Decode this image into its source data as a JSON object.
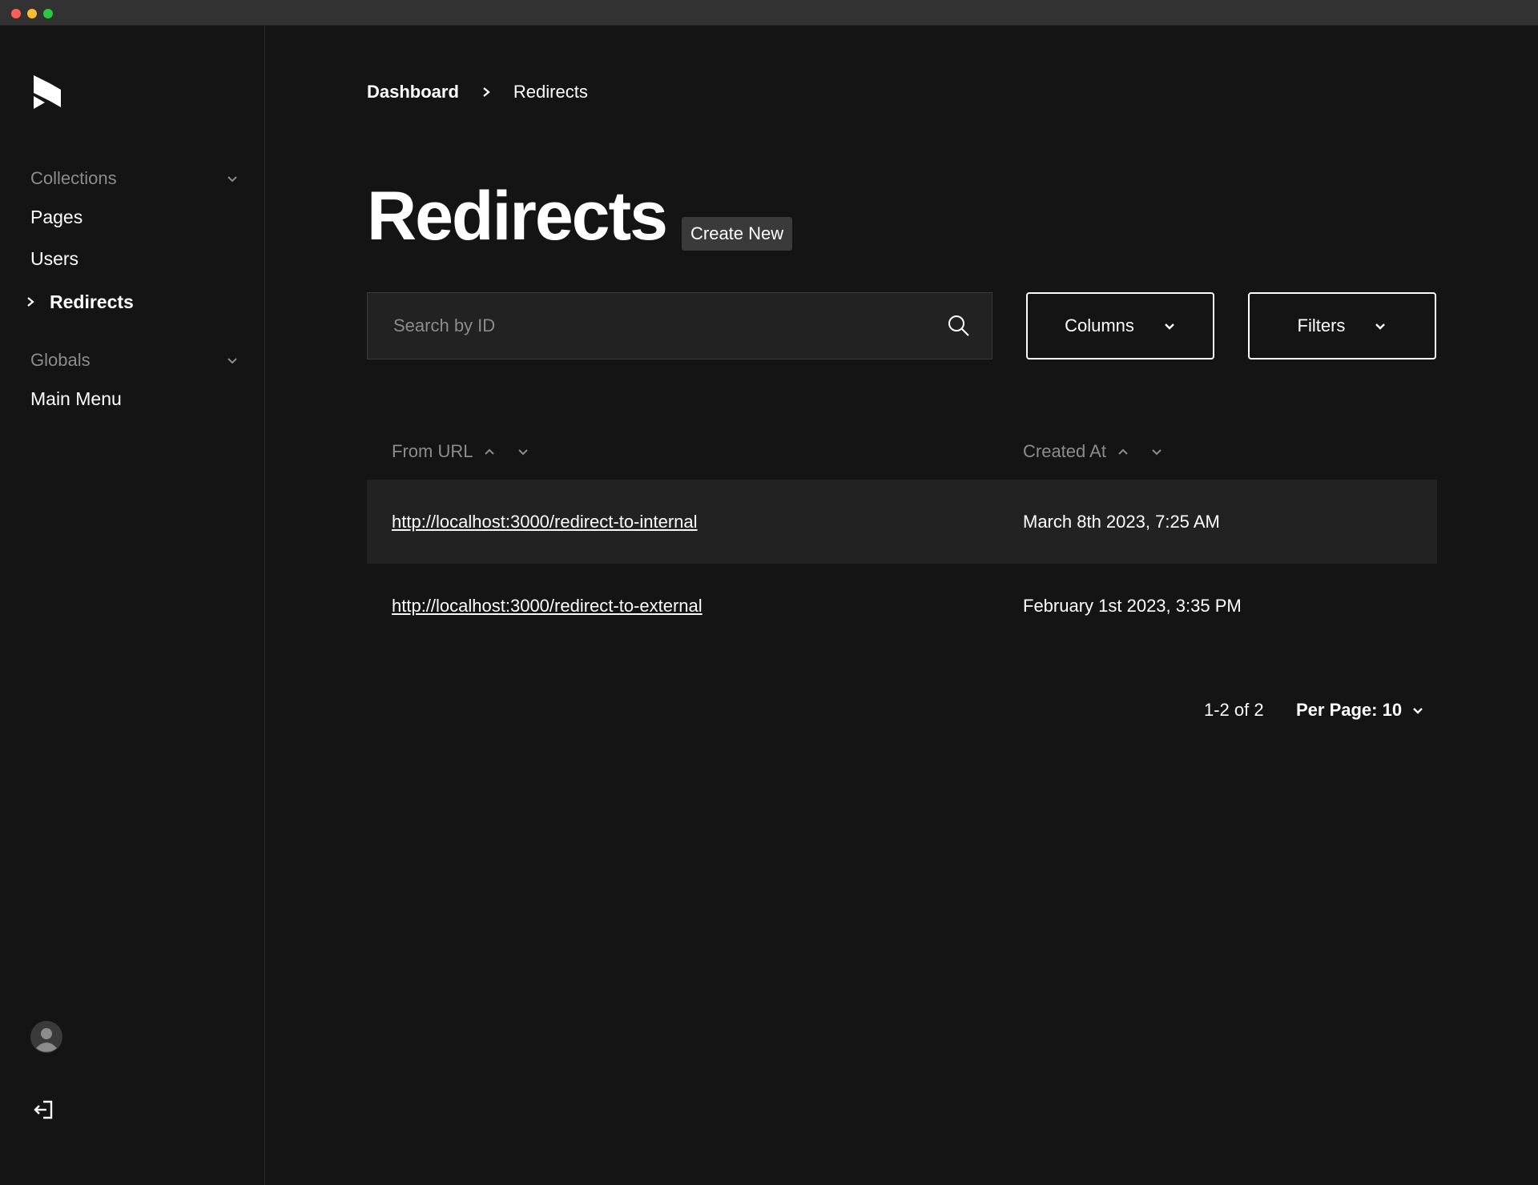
{
  "sidebar": {
    "logo_icon": "payload-logo-icon",
    "groups": [
      {
        "label": "Collections",
        "items": [
          "Pages",
          "Users",
          "Redirects"
        ]
      },
      {
        "label": "Globals",
        "items": [
          "Main Menu"
        ]
      }
    ],
    "active_item": "Redirects"
  },
  "breadcrumb": {
    "parent": "Dashboard",
    "current": "Redirects"
  },
  "page": {
    "title": "Redirects",
    "create_label": "Create New"
  },
  "search": {
    "placeholder": "Search by ID",
    "value": ""
  },
  "controls": {
    "columns_label": "Columns",
    "filters_label": "Filters"
  },
  "table": {
    "columns": [
      "From URL",
      "Created At"
    ],
    "rows": [
      {
        "from_url": "http://localhost:3000/redirect-to-internal",
        "created_at": "March 8th 2023, 7:25 AM"
      },
      {
        "from_url": "http://localhost:3000/redirect-to-external",
        "created_at": "February 1st 2023, 3:35 PM"
      }
    ]
  },
  "pagination": {
    "info": "1-2 of 2",
    "per_page_label": "Per Page: 10"
  },
  "colors": {
    "background": "#141414",
    "surface": "#222222",
    "muted_text": "#8c8c8c",
    "text": "#ffffff"
  }
}
